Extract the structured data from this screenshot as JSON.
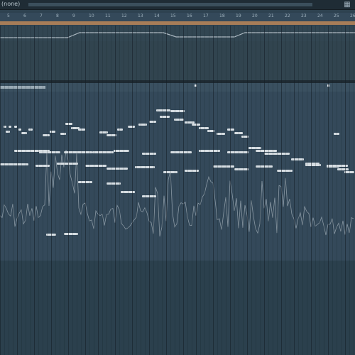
{
  "title_bar": {
    "title": "(none)",
    "accent_color": "#a77d58"
  },
  "ruler": {
    "bars": [
      "5",
      "6",
      "7",
      "8",
      "9",
      "10",
      "11",
      "12",
      "13",
      "14",
      "15",
      "16",
      "17",
      "18",
      "19",
      "20",
      "21",
      "22",
      "23",
      "24",
      "25",
      "26"
    ]
  },
  "icons": {
    "corner": "window-grid-icon"
  }
}
